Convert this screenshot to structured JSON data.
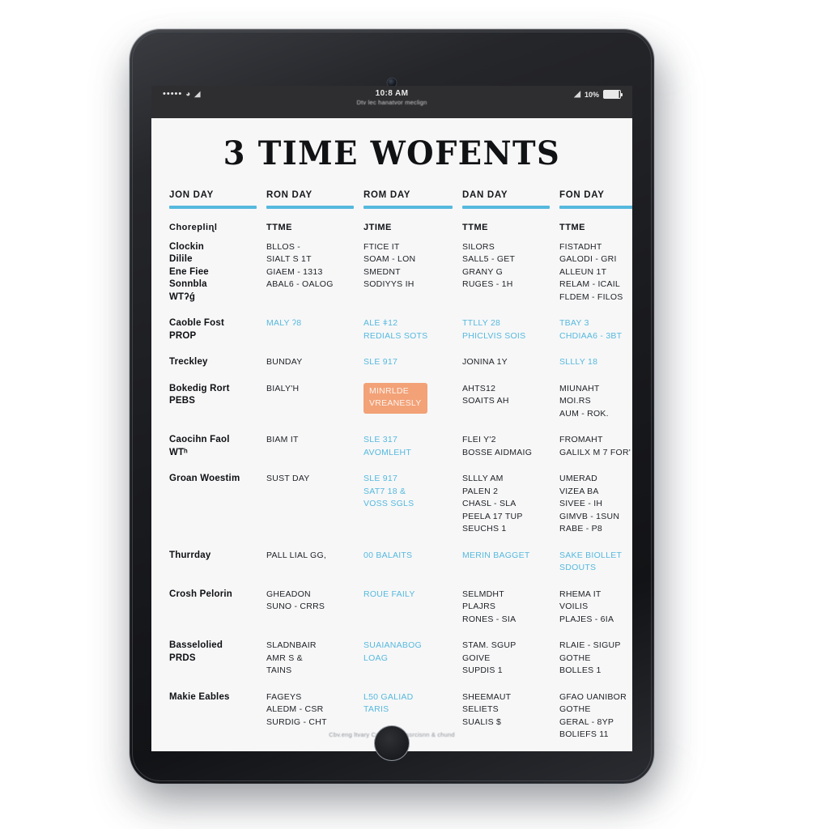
{
  "device": {
    "type": "tablet",
    "camera_icon": "front-camera",
    "home_button_icon": "home-button"
  },
  "status_bar": {
    "signal_dots": "•••••",
    "carrier_icon": "signal-icon",
    "wifi_icon": "ᴘ",
    "time": "10:8 AM",
    "subtitle": "Dtv lec hanatvor meclign",
    "right_wifi_icon": "◢",
    "battery_percent": "10%",
    "battery_icon": "battery-icon"
  },
  "page": {
    "title": "3 TIME WOFENTS",
    "footer_note": "Cbv.eng ltvary Cwarsf'y Obssrcisnn & chund",
    "accent_blue": "#56b9dd",
    "highlight_orange": "#f3a177",
    "background": "#f7f7f8"
  },
  "columns": [
    {
      "header": "JON DAY"
    },
    {
      "header": "RON DAY"
    },
    {
      "header": "ROM DAY"
    },
    {
      "header": "DAN DAY"
    },
    {
      "header": "FON DAY"
    }
  ],
  "rows": [
    {
      "cells": [
        {
          "lines": [
            {
              "text": "Chorepliɳl",
              "style": "head"
            },
            {
              "text": "",
              "style": "spacer"
            },
            {
              "text": "Clockin",
              "style": "strong"
            },
            {
              "text": "Dilile",
              "style": "strong"
            },
            {
              "text": "Ene Fiee",
              "style": "strong"
            },
            {
              "text": "Sonnbla",
              "style": "strong"
            },
            {
              "text": "WTʔǵ",
              "style": "strong"
            }
          ]
        },
        {
          "lines": [
            {
              "text": "TTME",
              "style": "head"
            },
            {
              "text": "",
              "style": "spacer"
            },
            {
              "text": "BLLOS -",
              "style": "plain"
            },
            {
              "text": "SIALT S 1T",
              "style": "plain"
            },
            {
              "text": "GIAEM - 1313",
              "style": "plain"
            },
            {
              "text": "ABAL6 - OALOG",
              "style": "plain"
            }
          ]
        },
        {
          "lines": [
            {
              "text": "JTIME",
              "style": "head"
            },
            {
              "text": "",
              "style": "spacer"
            },
            {
              "text": "FTICE IT",
              "style": "plain"
            },
            {
              "text": "SOAM - LON",
              "style": "plain"
            },
            {
              "text": "SMEDNT",
              "style": "plain"
            },
            {
              "text": "SODIYYS IH",
              "style": "plain"
            }
          ]
        },
        {
          "lines": [
            {
              "text": "TTME",
              "style": "head"
            },
            {
              "text": "",
              "style": "spacer"
            },
            {
              "text": "SILORS",
              "style": "plain"
            },
            {
              "text": "SALL5 - GET",
              "style": "plain"
            },
            {
              "text": "GRANY G",
              "style": "plain"
            },
            {
              "text": "RUGES - 1H",
              "style": "plain"
            }
          ]
        },
        {
          "lines": [
            {
              "text": "TTME",
              "style": "head"
            },
            {
              "text": "",
              "style": "spacer"
            },
            {
              "text": "FISTADHT",
              "style": "plain"
            },
            {
              "text": "GALODI - GRI",
              "style": "plain"
            },
            {
              "text": "ALLEUN 1T",
              "style": "plain"
            },
            {
              "text": "RELAM - ICAIL",
              "style": "plain"
            },
            {
              "text": "FLDEM -  FILOS",
              "style": "plain"
            }
          ]
        }
      ]
    },
    {
      "cells": [
        {
          "lines": [
            {
              "text": "Caoble Fost",
              "style": "strong"
            },
            {
              "text": "PROP",
              "style": "strong"
            }
          ]
        },
        {
          "lines": [
            {
              "text": "MALY ʔ8",
              "style": "blue"
            }
          ]
        },
        {
          "lines": [
            {
              "text": "ALE ǂ12",
              "style": "blue"
            },
            {
              "text": "REDIALS SOTS",
              "style": "blue"
            }
          ]
        },
        {
          "lines": [
            {
              "text": "TTLLY 28",
              "style": "blue"
            },
            {
              "text": "PHICLVIS SOIS",
              "style": "blue"
            }
          ]
        },
        {
          "lines": [
            {
              "text": "TBAY 3",
              "style": "blue"
            },
            {
              "text": "CHDIAA6 - 3BT",
              "style": "blue"
            }
          ]
        }
      ]
    },
    {
      "cells": [
        {
          "lines": [
            {
              "text": "Treckley",
              "style": "strong"
            }
          ]
        },
        {
          "lines": [
            {
              "text": "BUNDAY",
              "style": "plain"
            }
          ]
        },
        {
          "lines": [
            {
              "text": "SLE 917",
              "style": "blue"
            }
          ]
        },
        {
          "lines": [
            {
              "text": "JONINA 1Y",
              "style": "plain"
            }
          ]
        },
        {
          "lines": [
            {
              "text": "SLLLY 18",
              "style": "blue"
            }
          ]
        }
      ]
    },
    {
      "cells": [
        {
          "lines": [
            {
              "text": "Bokedig Rort",
              "style": "strong"
            },
            {
              "text": "PEBS",
              "style": "strong"
            }
          ]
        },
        {
          "lines": [
            {
              "text": "BIALY'H",
              "style": "plain"
            }
          ]
        },
        {
          "highlight": true,
          "lines": [
            {
              "text": "MINRLDE",
              "style": "plain"
            },
            {
              "text": "VREANESLY",
              "style": "plain"
            }
          ]
        },
        {
          "lines": [
            {
              "text": "AHTS12",
              "style": "plain"
            },
            {
              "text": "SOAITS AH",
              "style": "plain"
            }
          ]
        },
        {
          "lines": [
            {
              "text": "MIUNAHT",
              "style": "plain"
            },
            {
              "text": "MOI.RS",
              "style": "plain"
            },
            {
              "text": "AUM - ROK.",
              "style": "plain"
            }
          ]
        }
      ]
    },
    {
      "cells": [
        {
          "lines": [
            {
              "text": "Caocihn Faol",
              "style": "strong"
            },
            {
              "text": "WTʰ",
              "style": "strong"
            }
          ]
        },
        {
          "lines": [
            {
              "text": "BIAM IT",
              "style": "plain"
            }
          ]
        },
        {
          "lines": [
            {
              "text": "SLE 317",
              "style": "blue"
            },
            {
              "text": "AVOMLEHT",
              "style": "blue"
            }
          ]
        },
        {
          "lines": [
            {
              "text": "FLEI Y'2",
              "style": "plain"
            },
            {
              "text": "BOSSE AIDMAIG",
              "style": "plain"
            }
          ]
        },
        {
          "lines": [
            {
              "text": "FROMAHT",
              "style": "plain"
            },
            {
              "text": "GALILX M 7 FOR'",
              "style": "plain"
            }
          ]
        }
      ]
    },
    {
      "cells": [
        {
          "lines": [
            {
              "text": "Groan Woestim",
              "style": "strong"
            }
          ]
        },
        {
          "lines": [
            {
              "text": "SUST DAY",
              "style": "plain"
            }
          ]
        },
        {
          "lines": [
            {
              "text": "SLE 917",
              "style": "blue"
            },
            {
              "text": "SAT7 18 &",
              "style": "blue"
            },
            {
              "text": "VOSS SGLS",
              "style": "blue"
            }
          ]
        },
        {
          "lines": [
            {
              "text": "SLLLY AM",
              "style": "plain"
            },
            {
              "text": "PALEN 2",
              "style": "plain"
            },
            {
              "text": "CHASL - SLA",
              "style": "plain"
            },
            {
              "text": "PEELA  17 TUP",
              "style": "plain"
            },
            {
              "text": "SEUCHS 1",
              "style": "plain"
            }
          ]
        },
        {
          "lines": [
            {
              "text": "UMERAD",
              "style": "plain"
            },
            {
              "text": "VIZEA BA",
              "style": "plain"
            },
            {
              "text": "SIVEE - IH",
              "style": "plain"
            },
            {
              "text": "GIMVB - 1SUN",
              "style": "plain"
            },
            {
              "text": "RABE - P8",
              "style": "plain"
            }
          ]
        }
      ]
    },
    {
      "cells": [
        {
          "lines": [
            {
              "text": "Thurrday",
              "style": "strong"
            }
          ]
        },
        {
          "lines": [
            {
              "text": "PALL LIAL GG,",
              "style": "plain"
            }
          ]
        },
        {
          "lines": [
            {
              "text": "00 BALAITS",
              "style": "blue"
            }
          ]
        },
        {
          "lines": [
            {
              "text": "MERIN BAGGET",
              "style": "blue"
            }
          ]
        },
        {
          "lines": [
            {
              "text": "SAKE BIOLLET",
              "style": "blue"
            },
            {
              "text": "SDOUTS",
              "style": "blue"
            }
          ]
        }
      ]
    },
    {
      "cells": [
        {
          "lines": [
            {
              "text": "Crosh Pelorin",
              "style": "strong"
            }
          ]
        },
        {
          "lines": [
            {
              "text": "GHEADON",
              "style": "plain"
            },
            {
              "text": "SUNO - CRRS",
              "style": "plain"
            }
          ]
        },
        {
          "lines": [
            {
              "text": "ROUE FAILY",
              "style": "blue"
            }
          ]
        },
        {
          "lines": [
            {
              "text": "SELMDHT",
              "style": "plain"
            },
            {
              "text": "PLAJRS",
              "style": "plain"
            },
            {
              "text": "RONES - SIA",
              "style": "plain"
            }
          ]
        },
        {
          "lines": [
            {
              "text": "RHEMA IT",
              "style": "plain"
            },
            {
              "text": "VOILIS",
              "style": "plain"
            },
            {
              "text": "PLAJES - 6IA",
              "style": "plain"
            }
          ]
        }
      ]
    },
    {
      "cells": [
        {
          "lines": [
            {
              "text": "Basselolied",
              "style": "strong"
            },
            {
              "text": "PRDS",
              "style": "strong"
            }
          ]
        },
        {
          "lines": [
            {
              "text": "SLADNBAIR",
              "style": "plain"
            },
            {
              "text": "AMR S &",
              "style": "plain"
            },
            {
              "text": "TAINS",
              "style": "plain"
            }
          ]
        },
        {
          "lines": [
            {
              "text": "SUAIANABOG",
              "style": "blue"
            },
            {
              "text": "LOAG",
              "style": "blue"
            }
          ]
        },
        {
          "lines": [
            {
              "text": "STAM. SGUP",
              "style": "plain"
            },
            {
              "text": "GOIVE",
              "style": "plain"
            },
            {
              "text": "SUPDIS 1",
              "style": "plain"
            }
          ]
        },
        {
          "lines": [
            {
              "text": "RLAIE - SIGUP",
              "style": "plain"
            },
            {
              "text": "GOTHE",
              "style": "plain"
            },
            {
              "text": "BOLLES 1",
              "style": "plain"
            }
          ]
        }
      ]
    },
    {
      "cells": [
        {
          "lines": [
            {
              "text": "Makie Eables",
              "style": "strong"
            }
          ]
        },
        {
          "lines": [
            {
              "text": "FAGEYS",
              "style": "plain"
            },
            {
              "text": "ALEDM - CSR",
              "style": "plain"
            },
            {
              "text": "SURDIG - CHT",
              "style": "plain"
            }
          ]
        },
        {
          "lines": [
            {
              "text": "L50 GALIAD",
              "style": "blue"
            },
            {
              "text": "TARIS",
              "style": "blue"
            }
          ]
        },
        {
          "lines": [
            {
              "text": "SHEEMAUT",
              "style": "plain"
            },
            {
              "text": "SELIETS",
              "style": "plain"
            },
            {
              "text": "SUALIS $",
              "style": "plain"
            }
          ]
        },
        {
          "lines": [
            {
              "text": "GFAO UANIBOR",
              "style": "plain"
            },
            {
              "text": "GOTHE",
              "style": "plain"
            },
            {
              "text": "GERAL - 8YP",
              "style": "plain"
            },
            {
              "text": "BOLIEFS 11",
              "style": "plain"
            }
          ]
        }
      ]
    }
  ]
}
